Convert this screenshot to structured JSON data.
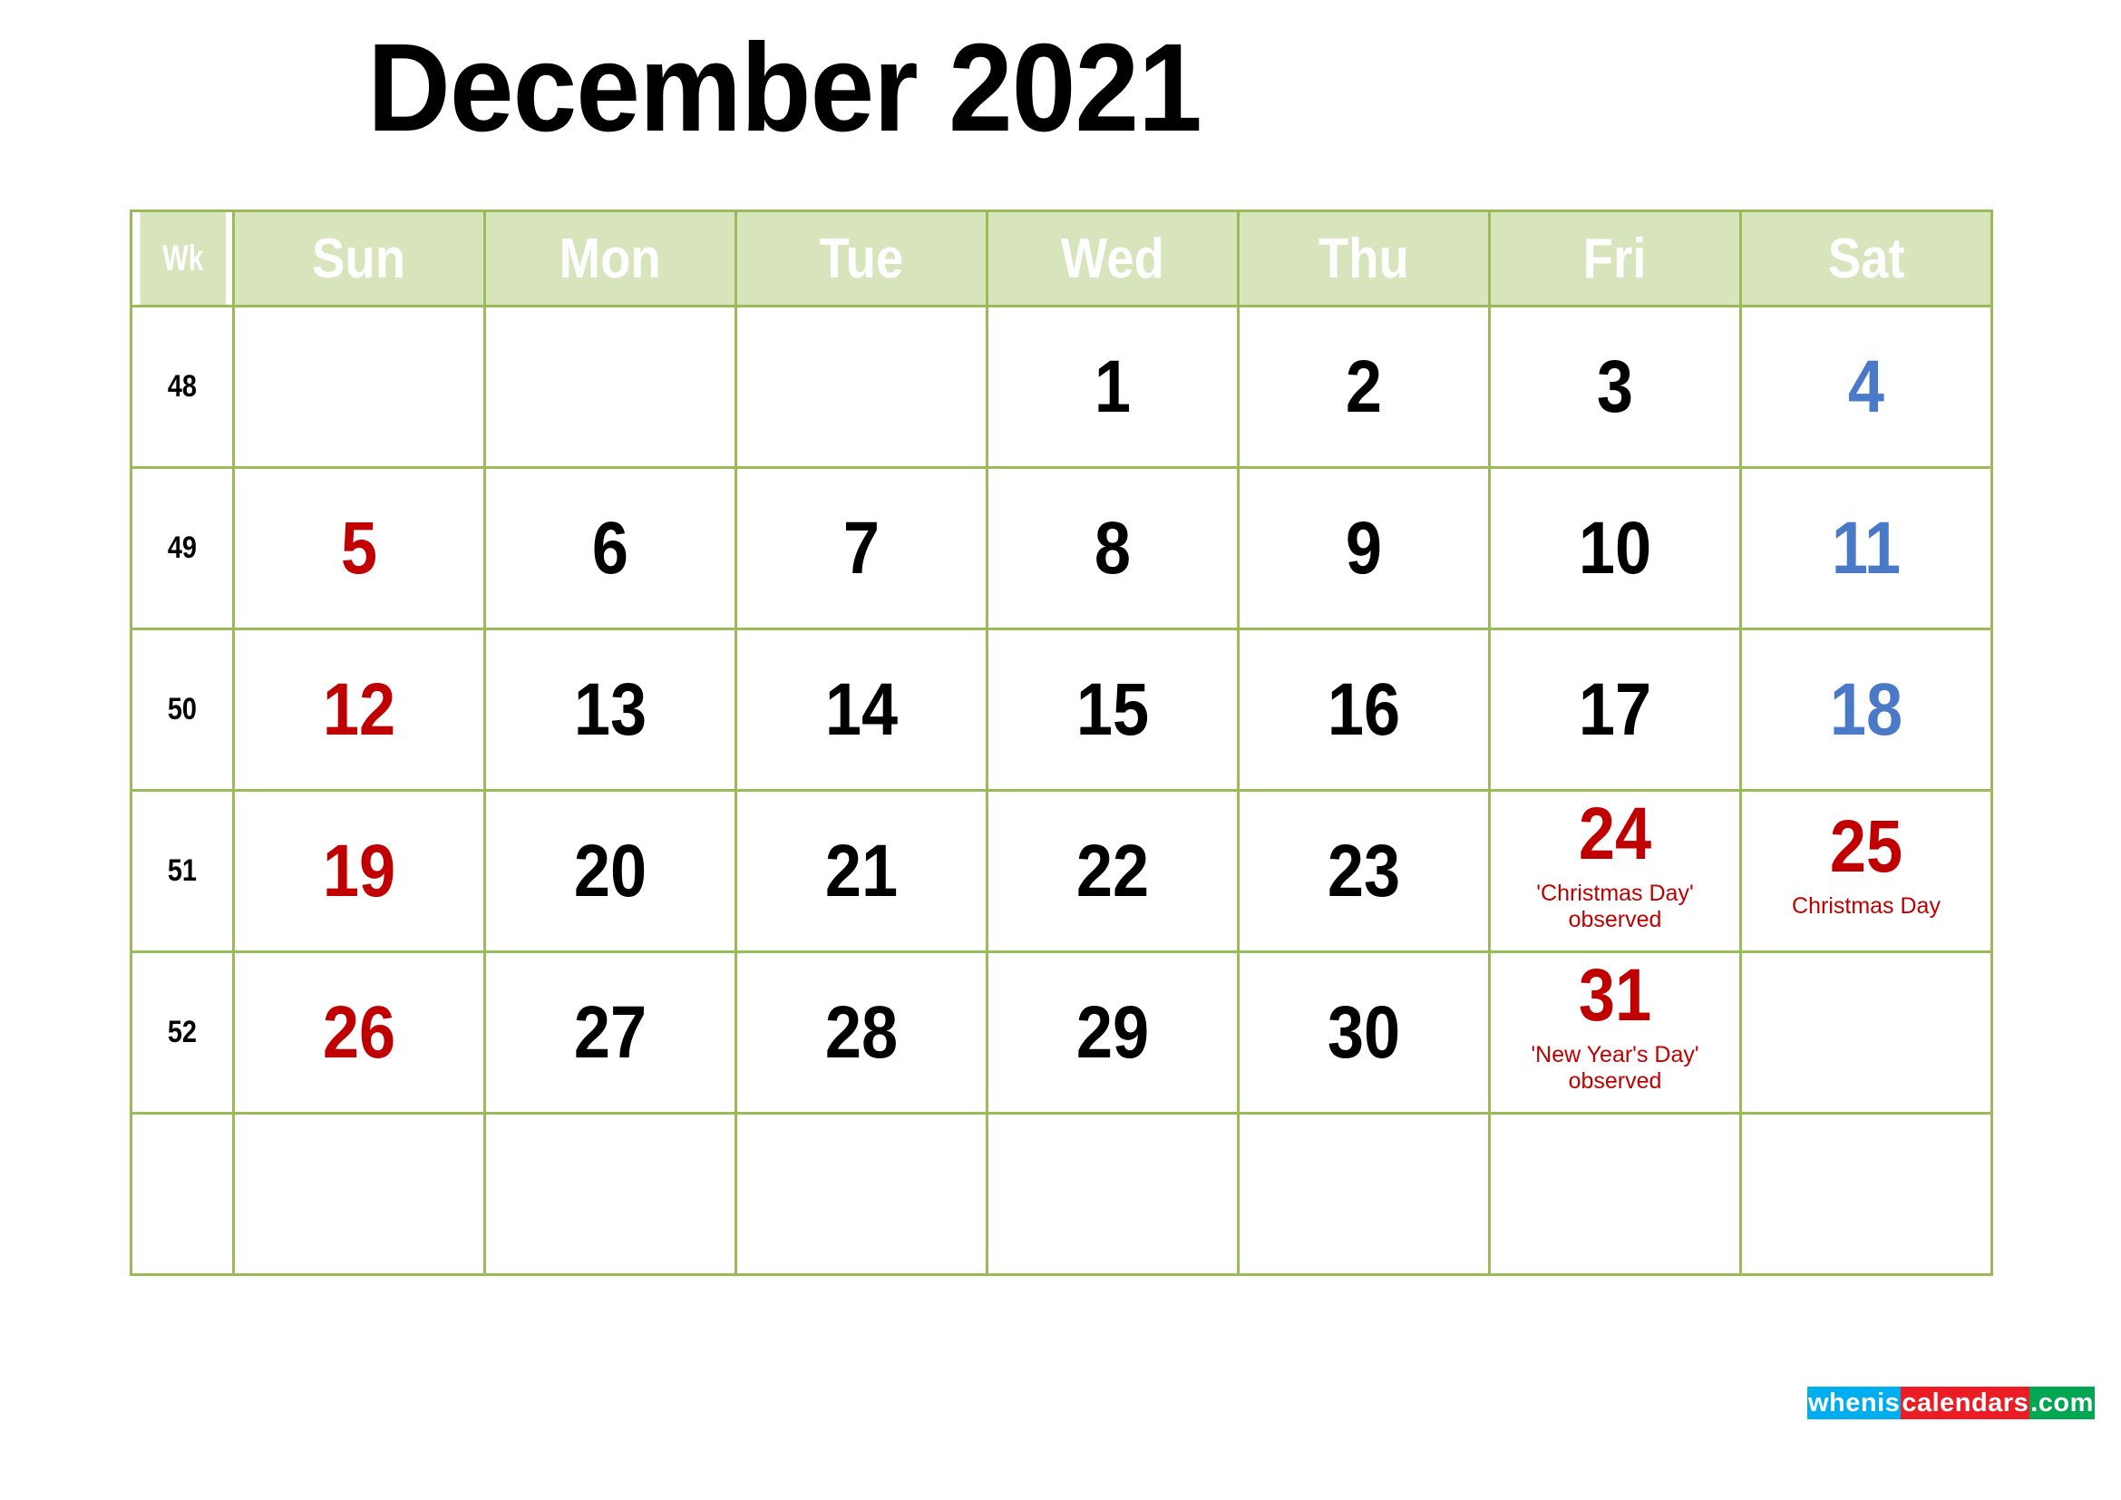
{
  "title": "December 2021",
  "colors": {
    "border": "#9bbb59",
    "shade": "#d8e4bc",
    "header_bg": "#d8e4bc",
    "header_text": "#ffffff",
    "sunday": "#c00000",
    "saturday": "#4a7ac7",
    "weekday": "#000000",
    "holiday": "#c00000",
    "logo_blue": "#00aeef",
    "logo_red": "#ec1c24",
    "logo_green": "#00a651"
  },
  "headers": {
    "week": "Wk",
    "days": [
      "Sun",
      "Mon",
      "Tue",
      "Wed",
      "Thu",
      "Fri",
      "Sat"
    ]
  },
  "weeks": [
    {
      "wk": "48",
      "shaded": false,
      "days": [
        {
          "num": "",
          "note": "",
          "kind": "sun"
        },
        {
          "num": "",
          "note": "",
          "kind": "weekday"
        },
        {
          "num": "",
          "note": "",
          "kind": "weekday"
        },
        {
          "num": "1",
          "note": "",
          "kind": "weekday"
        },
        {
          "num": "2",
          "note": "",
          "kind": "weekday"
        },
        {
          "num": "3",
          "note": "",
          "kind": "weekday"
        },
        {
          "num": "4",
          "note": "",
          "kind": "sat"
        }
      ]
    },
    {
      "wk": "49",
      "shaded": true,
      "days": [
        {
          "num": "5",
          "note": "",
          "kind": "sun"
        },
        {
          "num": "6",
          "note": "",
          "kind": "weekday"
        },
        {
          "num": "7",
          "note": "",
          "kind": "weekday"
        },
        {
          "num": "8",
          "note": "",
          "kind": "weekday"
        },
        {
          "num": "9",
          "note": "",
          "kind": "weekday"
        },
        {
          "num": "10",
          "note": "",
          "kind": "weekday"
        },
        {
          "num": "11",
          "note": "",
          "kind": "sat"
        }
      ]
    },
    {
      "wk": "50",
      "shaded": false,
      "days": [
        {
          "num": "12",
          "note": "",
          "kind": "sun"
        },
        {
          "num": "13",
          "note": "",
          "kind": "weekday"
        },
        {
          "num": "14",
          "note": "",
          "kind": "weekday"
        },
        {
          "num": "15",
          "note": "",
          "kind": "weekday"
        },
        {
          "num": "16",
          "note": "",
          "kind": "weekday"
        },
        {
          "num": "17",
          "note": "",
          "kind": "weekday"
        },
        {
          "num": "18",
          "note": "",
          "kind": "sat"
        }
      ]
    },
    {
      "wk": "51",
      "shaded": true,
      "days": [
        {
          "num": "19",
          "note": "",
          "kind": "sun"
        },
        {
          "num": "20",
          "note": "",
          "kind": "weekday"
        },
        {
          "num": "21",
          "note": "",
          "kind": "weekday"
        },
        {
          "num": "22",
          "note": "",
          "kind": "weekday"
        },
        {
          "num": "23",
          "note": "",
          "kind": "weekday"
        },
        {
          "num": "24",
          "note": "'Christmas Day'\nobserved",
          "kind": "holiday"
        },
        {
          "num": "25",
          "note": "Christmas Day",
          "kind": "holiday"
        }
      ]
    },
    {
      "wk": "52",
      "shaded": false,
      "days": [
        {
          "num": "26",
          "note": "",
          "kind": "sun"
        },
        {
          "num": "27",
          "note": "",
          "kind": "weekday"
        },
        {
          "num": "28",
          "note": "",
          "kind": "weekday"
        },
        {
          "num": "29",
          "note": "",
          "kind": "weekday"
        },
        {
          "num": "30",
          "note": "",
          "kind": "weekday"
        },
        {
          "num": "31",
          "note": "'New Year's Day'\nobserved",
          "kind": "holiday"
        },
        {
          "num": "",
          "note": "",
          "kind": "sat"
        }
      ]
    },
    {
      "wk": "",
      "shaded": true,
      "empty": true,
      "days": [
        {
          "num": "",
          "note": "",
          "kind": "sun"
        },
        {
          "num": "",
          "note": "",
          "kind": "weekday"
        },
        {
          "num": "",
          "note": "",
          "kind": "weekday"
        },
        {
          "num": "",
          "note": "",
          "kind": "weekday"
        },
        {
          "num": "",
          "note": "",
          "kind": "weekday"
        },
        {
          "num": "",
          "note": "",
          "kind": "weekday"
        },
        {
          "num": "",
          "note": "",
          "kind": "sat"
        }
      ]
    }
  ],
  "logo": {
    "part1": "whenis",
    "part2": "calendars",
    "part3": ".com"
  }
}
